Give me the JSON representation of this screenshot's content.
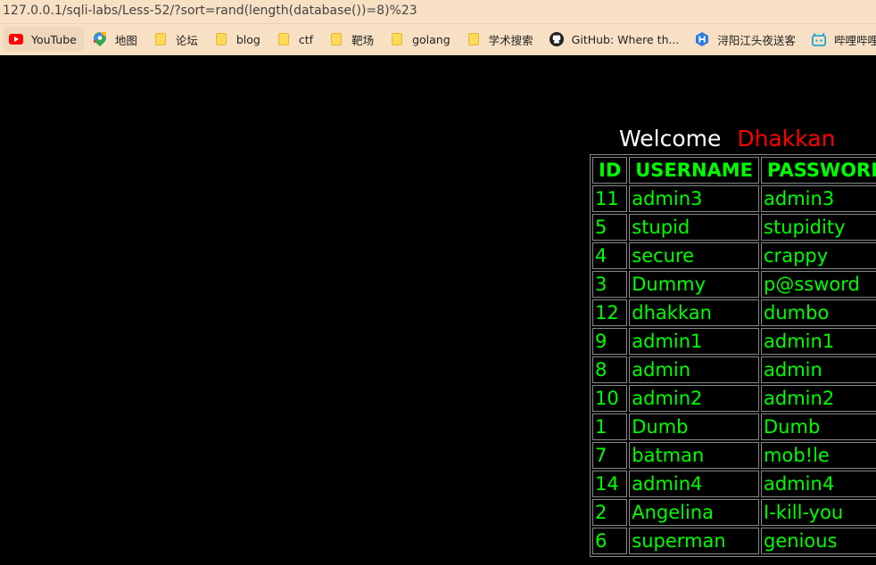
{
  "browser": {
    "url": "127.0.0.1/sqli-labs/Less-52/?sort=rand(length(database())=8)%23",
    "bookmarks": [
      {
        "label": "YouTube",
        "icon": "youtube-icon"
      },
      {
        "label": "地图",
        "icon": "maps-icon"
      },
      {
        "label": "论坛",
        "icon": "folder-icon"
      },
      {
        "label": "blog",
        "icon": "folder-icon"
      },
      {
        "label": "ctf",
        "icon": "folder-icon"
      },
      {
        "label": "靶场",
        "icon": "folder-icon"
      },
      {
        "label": "golang",
        "icon": "folder-icon"
      },
      {
        "label": "学术搜索",
        "icon": "folder-icon"
      },
      {
        "label": "GitHub: Where th...",
        "icon": "github-icon"
      },
      {
        "label": "浔阳江头夜送客",
        "icon": "hexagon-h-icon"
      },
      {
        "label": "哔哩哔哩 (゜-゜)つ",
        "icon": "bilibili-icon"
      }
    ]
  },
  "page": {
    "welcome": "Welcome",
    "name": "Dhakkan",
    "colors": {
      "text": "#00ff00",
      "welcome": "#ffffff",
      "name": "#ff0000",
      "background": "#000000"
    },
    "table": {
      "headers": [
        "ID",
        "USERNAME",
        "PASSWORD"
      ],
      "rows": [
        [
          "11",
          "admin3",
          "admin3"
        ],
        [
          "5",
          "stupid",
          "stupidity"
        ],
        [
          "4",
          "secure",
          "crappy"
        ],
        [
          "3",
          "Dummy",
          "p@ssword"
        ],
        [
          "12",
          "dhakkan",
          "dumbo"
        ],
        [
          "9",
          "admin1",
          "admin1"
        ],
        [
          "8",
          "admin",
          "admin"
        ],
        [
          "10",
          "admin2",
          "admin2"
        ],
        [
          "1",
          "Dumb",
          "Dumb"
        ],
        [
          "7",
          "batman",
          "mob!le"
        ],
        [
          "14",
          "admin4",
          "admin4"
        ],
        [
          "2",
          "Angelina",
          "I-kill-you"
        ],
        [
          "6",
          "superman",
          "genious"
        ]
      ]
    }
  }
}
